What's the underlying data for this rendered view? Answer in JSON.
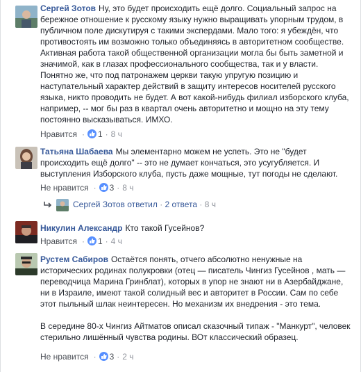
{
  "comments": [
    {
      "author": "Сергей Зотов",
      "paragraphs": [
        "Ну, это будет происходить ещё долго. Социальный запрос на бережное отношение к русскому языку нужно выращивать упорным трудом, в публичном поле дискутируя с такими экспердами. Мало того: я убеждён, что противостоять им возможно только объединяясь в авторитетном сообществе. Активная работа такой общественной организации могла бы быть заметной и значимой, как в глазах профессионального сообщества, так и у власти. Понятно же, что под патронажем церкви такую упругую позицию и наступательный характер действий в защиту интересов носителей русского языка, никто проводить не будет. А вот какой-нибудь филиал изборского клуба, например, -- мог бы раз в квартал очень авторитетно и мощно на эту тему постоянно высказываться. ИМХО."
      ],
      "action": "Нравится",
      "likes": "1",
      "time": "8 ч"
    },
    {
      "author": "Татьяна Шабаева",
      "paragraphs": [
        "Мы элементарно можем не успеть. Это не \"будет происходить ещё долго\" -- это не думает кончаться, это усугубляется. И выступления Изборского клуба, пусть даже мощные, тут погоды не сделают."
      ],
      "action": "Не нравится",
      "likes": "3",
      "time": "8 ч"
    },
    {
      "author": "Никулин Александр",
      "paragraphs": [
        "Кто такой Гусейнов?"
      ],
      "action": "Нравится",
      "likes": "1",
      "time": "4 ч"
    },
    {
      "author": "Рустем Сабиров",
      "paragraphs": [
        "Остаётся понять, отчего абсолютно ненужные на исторических родинах полукровки (отец — писатель Чингиз Гусейнов , мать — переводчица Марина Гринблат), которых в упор не знают ни в Азербайджане, ни в Израиле, имеют такой солидный вес и авторитет в России. Сам по себе этот пыльный шлак неинтересен. Но механизм их внедрения - это тема.",
        "В середине 80-х Чингиз Айтматов описал сказочный типаж - \"Манкурт\", человек стерильно лишённый чувства родины. ВОт классический образец."
      ],
      "action": "Не нравится",
      "likes": "3",
      "time": "2 ч"
    }
  ],
  "replies": {
    "author": "Сергей Зотов",
    "verb": "ответил",
    "count": "2 ответа",
    "time": "8 ч"
  },
  "colors": {
    "link": "#365899",
    "meta": "#90949c",
    "like_badge": "#5890ff"
  },
  "icons": [
    "like-icon",
    "reply-arrow-icon"
  ]
}
